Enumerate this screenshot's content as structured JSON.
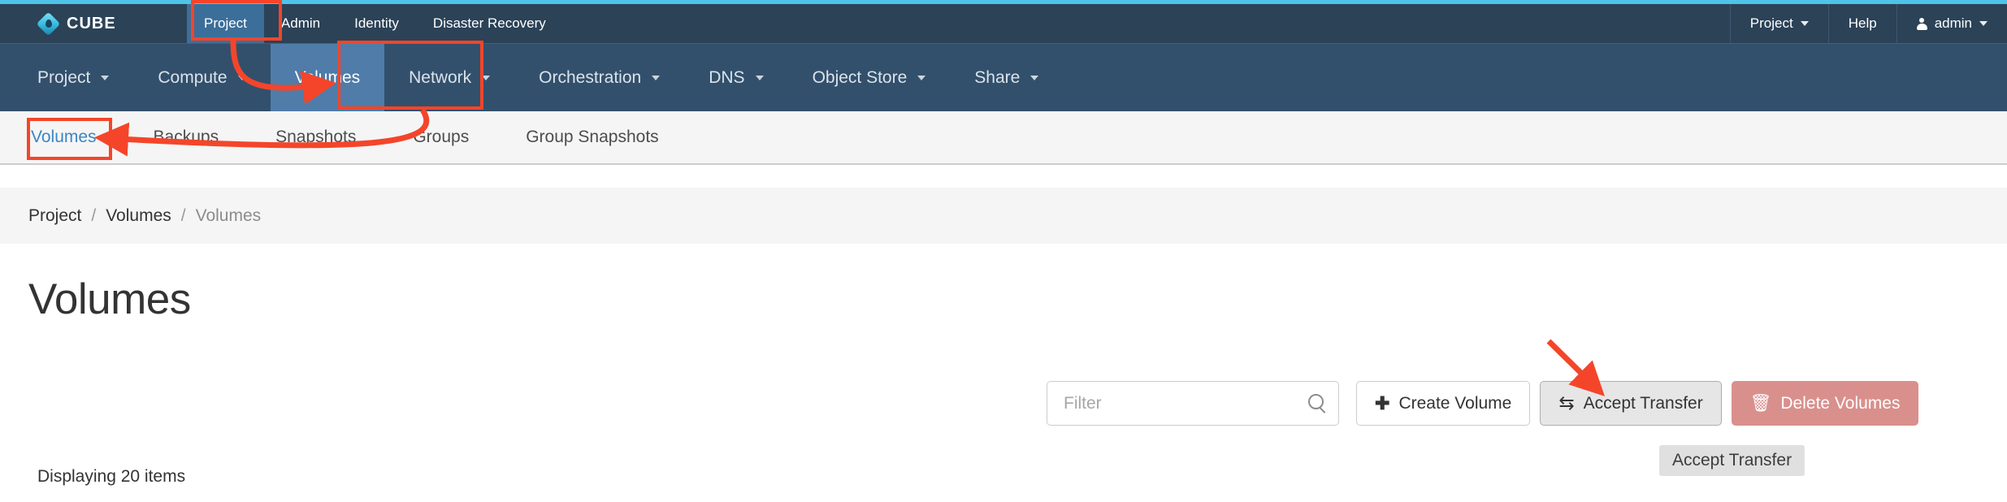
{
  "brand": {
    "name": "CUBE",
    "logo_icon": "cube-diamond-logo",
    "accent": "#4fc3e8"
  },
  "topnav": {
    "items": [
      {
        "label": "Project",
        "active": true
      },
      {
        "label": "Admin",
        "active": false
      },
      {
        "label": "Identity",
        "active": false
      },
      {
        "label": "Disaster Recovery",
        "active": false
      }
    ],
    "right": [
      {
        "label": "Project",
        "icon": "chevron-down-icon"
      },
      {
        "label": "Help",
        "icon": ""
      },
      {
        "label": "admin",
        "icon": "user-icon"
      }
    ]
  },
  "subnav": {
    "items": [
      {
        "label": "Project",
        "caret": true,
        "active": false
      },
      {
        "label": "Compute",
        "caret": true,
        "active": false
      },
      {
        "label": "Volumes",
        "caret": false,
        "active": true
      },
      {
        "label": "Network",
        "caret": true,
        "active": false
      },
      {
        "label": "Orchestration",
        "caret": true,
        "active": false
      },
      {
        "label": "DNS",
        "caret": true,
        "active": false
      },
      {
        "label": "Object Store",
        "caret": true,
        "active": false
      },
      {
        "label": "Share",
        "caret": true,
        "active": false
      }
    ]
  },
  "tabs": [
    {
      "label": "Volumes",
      "active": true
    },
    {
      "label": "Backups",
      "active": false
    },
    {
      "label": "Snapshots",
      "active": false
    },
    {
      "label": "Groups",
      "active": false
    },
    {
      "label": "Group Snapshots",
      "active": false
    }
  ],
  "breadcrumb": {
    "items": [
      "Project",
      "Volumes",
      "Volumes"
    ],
    "separator": "/"
  },
  "main": {
    "title": "Volumes",
    "displaying": "Displaying 20 items"
  },
  "toolbar": {
    "filter_placeholder": "Filter",
    "filter_value": "",
    "search_icon": "search-icon",
    "create_label": "Create Volume",
    "create_icon": "plus-icon",
    "accept_label": "Accept Transfer",
    "accept_icon": "transfer-arrows-icon",
    "delete_label": "Delete Volumes",
    "delete_icon": "trash-icon",
    "delete_color": "#d9908c"
  },
  "tooltip": {
    "text": "Accept Transfer"
  },
  "annotations": {
    "color": "#f4452a",
    "boxes": [
      "Project (top nav)",
      "Volumes (sub nav)",
      "Volumes (tab)"
    ],
    "arrows": [
      "Project -> Volumes",
      "Volumes -> Volumes tab",
      "pointer -> Accept Transfer"
    ]
  }
}
